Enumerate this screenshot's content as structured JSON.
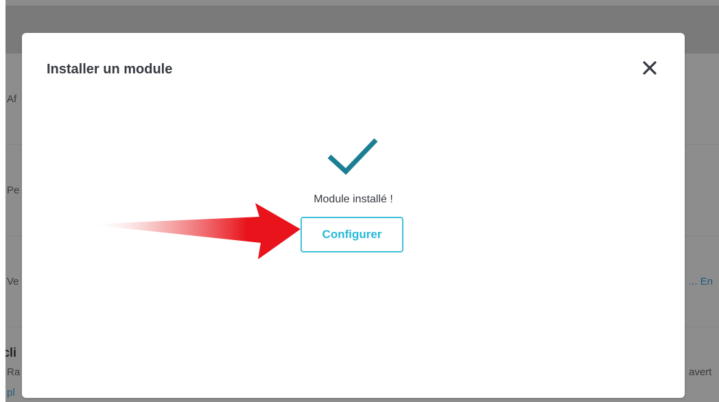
{
  "background": {
    "row_fragments": [
      "Af",
      "Pe",
      "Ve",
      "cli",
      "Ra",
      "pl"
    ],
    "right_fragments": [
      "... En",
      "avert"
    ]
  },
  "modal": {
    "title": "Installer un module",
    "close_icon": "close-icon",
    "success_icon": "checkmark-icon",
    "status_text": "Module installé !",
    "configure_label": "Configurer"
  },
  "colors": {
    "accent": "#25b9d7",
    "checkmark": "#1c7e94",
    "overlay": "#8c8c8c",
    "arrow": "#e8131b"
  }
}
